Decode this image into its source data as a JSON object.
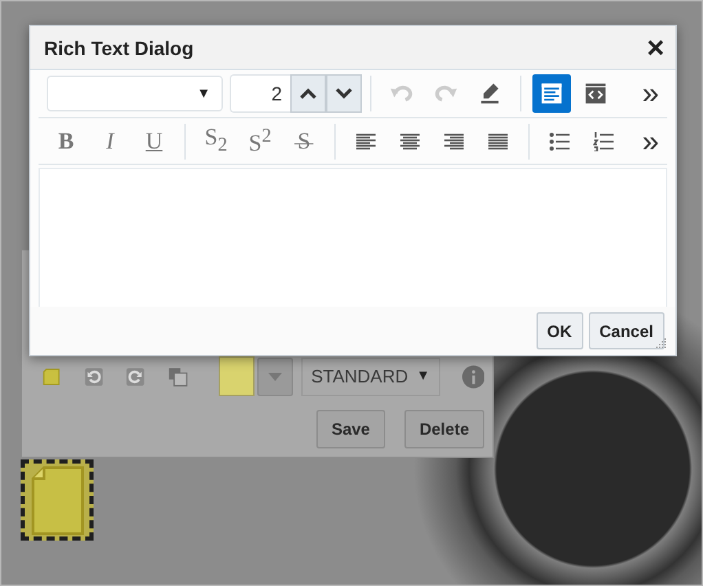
{
  "background_panel": {
    "tools": [
      {
        "kind": "note"
      },
      {
        "kind": "rotate-left"
      },
      {
        "kind": "rotate-right"
      },
      {
        "kind": "layers"
      }
    ],
    "color_swatch": {
      "color": "#d9d36e"
    },
    "style_select": {
      "value": "STANDARD",
      "arrow": "▼"
    },
    "buttons": [
      "Save",
      "Delete"
    ]
  },
  "note": {
    "selected": true
  },
  "dialog": {
    "title": "Rich Text Dialog",
    "close": "×",
    "font_select": {
      "arrow": "▼"
    },
    "size_field": {
      "value": "2"
    },
    "toolbar_1": [
      {
        "kind": "undo",
        "disabled": true,
        "selected": false
      },
      {
        "kind": "redo",
        "disabled": true,
        "selected": false
      },
      {
        "kind": "eraser",
        "disabled": false,
        "selected": false
      },
      {
        "kind": "rich-view",
        "disabled": false,
        "selected": true
      },
      {
        "kind": "source-view",
        "disabled": false,
        "selected": false
      }
    ],
    "overflow_1": "»",
    "toolbar_2": [
      {
        "kind": "bold",
        "label": "B"
      },
      {
        "kind": "italic",
        "label": "I"
      },
      {
        "kind": "underline",
        "label": "U"
      },
      {
        "kind": "subscript",
        "label": "S$_{2}$"
      },
      {
        "kind": "superscript",
        "label": "S$^{2}$"
      },
      {
        "kind": "strike",
        "label": "S"
      },
      {
        "kind": "align-left"
      },
      {
        "kind": "align-center"
      },
      {
        "kind": "align-right"
      },
      {
        "kind": "justify"
      },
      {
        "kind": "bullet-list"
      },
      {
        "kind": "numbered-list"
      }
    ],
    "overflow_2": "»",
    "buttons": [
      "OK",
      "Cancel"
    ]
  }
}
